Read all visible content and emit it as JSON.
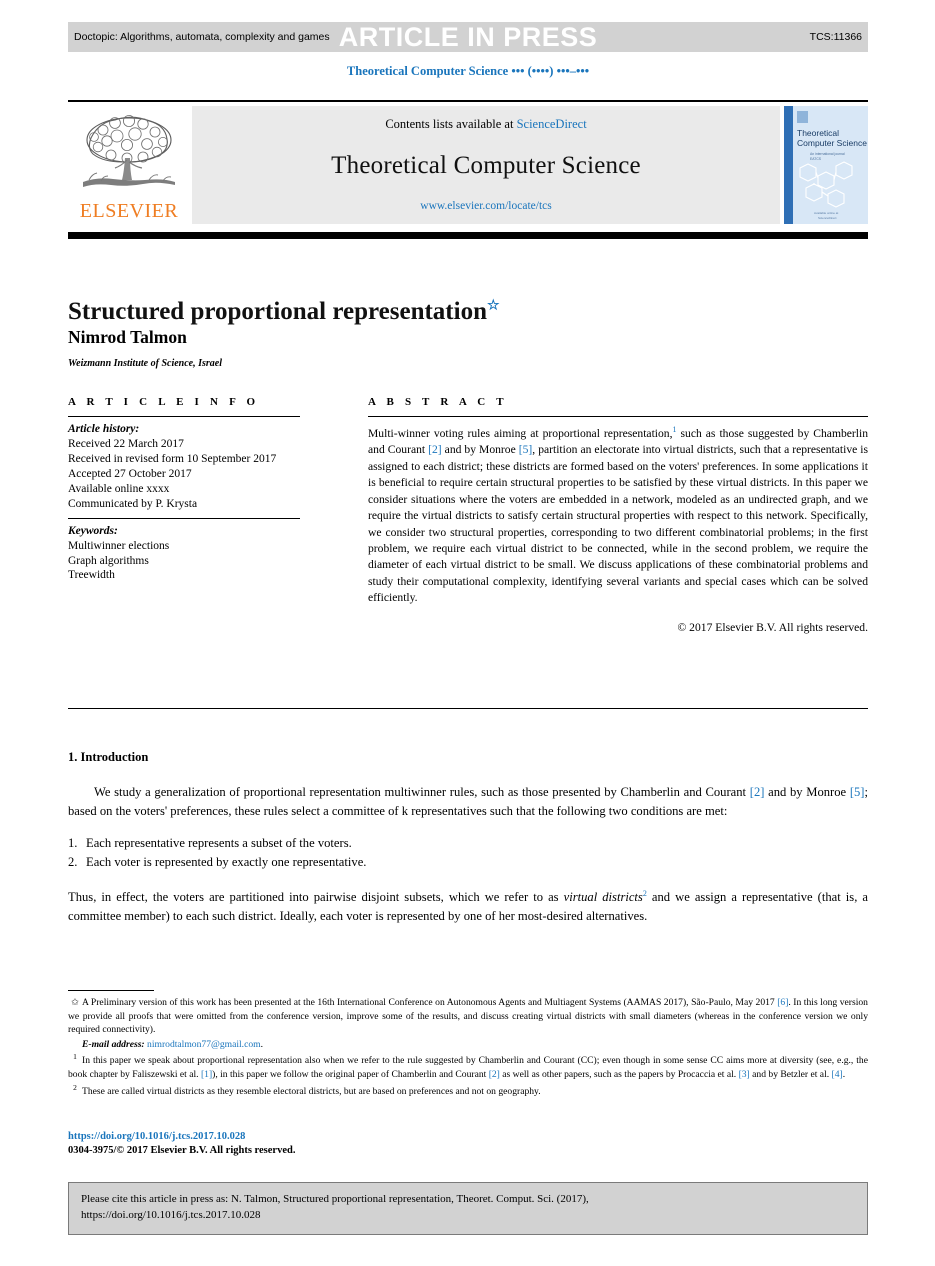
{
  "press_band": {
    "doctopic": "Doctopic: Algorithms, automata, complexity and games",
    "article_in_press": "ARTICLE IN PRESS",
    "tcs_code": "TCS:11366"
  },
  "running_head": "Theoretical Computer Science ••• (••••) •••–•••",
  "masthead": {
    "contents_prefix": "Contents lists available at ",
    "sciencedirect": "ScienceDirect",
    "journal_name": "Theoretical Computer Science",
    "journal_url": "www.elsevier.com/locate/tcs",
    "publisher": "ELSEVIER",
    "cover_title_line1": "Theoretical",
    "cover_title_line2": "Computer Science"
  },
  "article": {
    "title": "Structured proportional representation",
    "title_star": "☆",
    "author": "Nimrod Talmon",
    "affiliation": "Weizmann Institute of Science, Israel"
  },
  "info": {
    "heading": "A R T I C L E  I N F O",
    "history_label": "Article history:",
    "history": [
      "Received 22 March 2017",
      "Received in revised form 10 September 2017",
      "Accepted 27 October 2017",
      "Available online xxxx",
      "Communicated by P. Krysta"
    ],
    "keywords_label": "Keywords:",
    "keywords": [
      "Multiwinner elections",
      "Graph algorithms",
      "Treewidth"
    ]
  },
  "abstract": {
    "heading": "A B S T R A C T",
    "p1_a": "Multi-winner voting rules aiming at proportional representation,",
    "p1_sup": "1",
    "p1_b": " such as those suggested by Chamberlin and Courant ",
    "ref2": "[2]",
    "p1_c": " and by Monroe ",
    "ref5": "[5]",
    "p1_d": ", partition an electorate into virtual districts, such that a representative is assigned to each district; these districts are formed based on the voters' preferences. In some applications it is beneficial to require certain structural properties to be satisfied by these virtual districts. In this paper we consider situations where the voters are embedded in a network, modeled as an undirected graph, and we require the virtual districts to satisfy certain structural properties with respect to this network. Specifically, we consider two structural properties, corresponding to two different combinatorial problems; in the first problem, we require each virtual district to be connected, while in the second problem, we require the diameter of each virtual district to be small. We discuss applications of these combinatorial problems and study their computational complexity, identifying several variants and special cases which can be solved efficiently.",
    "copyright": "© 2017 Elsevier B.V. All rights reserved."
  },
  "introduction": {
    "heading": "1. Introduction",
    "p1_a": "We study a generalization of proportional representation multiwinner rules, such as those presented by Chamberlin and Courant ",
    "ref2": "[2]",
    "p1_b": " and by Monroe ",
    "ref5": "[5]",
    "p1_c": "; based on the voters' preferences, these rules select a committee of k representatives such that the following two conditions are met:",
    "list": [
      {
        "n": "1.",
        "text": "Each representative represents a subset of the voters."
      },
      {
        "n": "2.",
        "text": "Each voter is represented by exactly one representative."
      }
    ],
    "p2_a": "Thus, in effect, the voters are partitioned into pairwise disjoint subsets, which we refer to as ",
    "p2_italic": "virtual districts",
    "p2_sup": "2",
    "p2_b": " and we assign a representative (that is, a committee member) to each such district. Ideally, each voter is represented by one of her most-desired alternatives."
  },
  "footnotes": {
    "star_mark": "✩",
    "star_a": "A Preliminary version of this work has been presented at the 16th International Conference on Autonomous Agents and Multiagent Systems (AAMAS 2017), São-Paulo, May 2017 ",
    "star_ref6": "[6]",
    "star_b": ". In this long version we provide all proofs that were omitted from the conference version, improve some of the results, and discuss creating virtual districts with small diameters (whereas in the conference version we only required connectivity).",
    "email_label": "E-mail address:",
    "email": "nimrodtalmon77@gmail.com",
    "email_end": ".",
    "fn1_mark": "1",
    "fn1_a": "In this paper we speak about proportional representation also when we refer to the rule suggested by Chamberlin and Courant (CC); even though in some sense CC aims more at diversity (see, e.g., the book chapter by Faliszewski et al. ",
    "fn1_ref1": "[1]",
    "fn1_b": "), in this paper we follow the original paper of Chamberlin and Courant ",
    "fn1_ref2": "[2]",
    "fn1_c": " as well as other papers, such as the papers by Procaccia et al. ",
    "fn1_ref3": "[3]",
    "fn1_d": " and by Betzler et al. ",
    "fn1_ref4": "[4]",
    "fn1_e": ".",
    "fn2_mark": "2",
    "fn2_text": "These are called virtual districts as they resemble electoral districts, but are based on preferences and not on geography."
  },
  "footer": {
    "doi": "https://doi.org/10.1016/j.tcs.2017.10.028",
    "issn": "0304-3975/© 2017 Elsevier B.V. All rights reserved.",
    "cite_line1": "Please cite this article in press as: N. Talmon, Structured proportional representation, Theoret. Comput. Sci. (2017),",
    "cite_line2": "https://doi.org/10.1016/j.tcs.2017.10.028"
  },
  "colors": {
    "link": "#1a75bc",
    "band": "#d2d2d2",
    "mast_panel": "#eaeaea",
    "elsevier_orange": "#ef7d22"
  }
}
